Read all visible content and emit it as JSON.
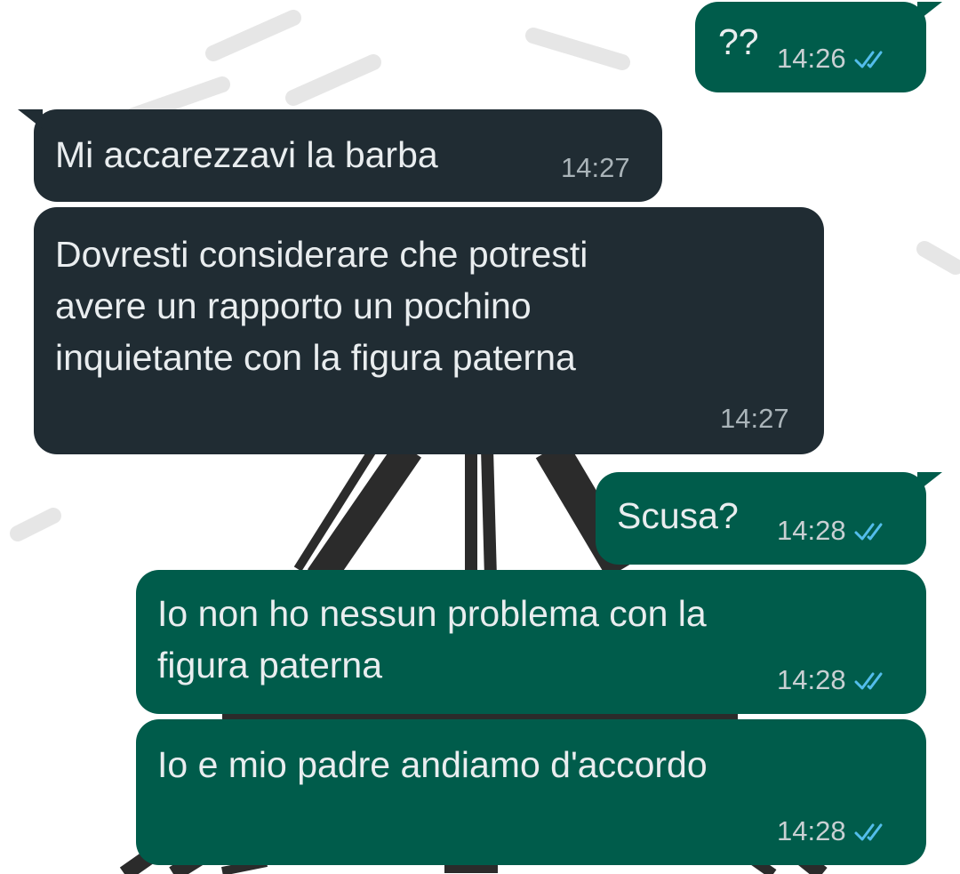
{
  "chat": {
    "messages": [
      {
        "id": "m1",
        "direction": "outgoing",
        "lines": [
          "??"
        ],
        "time": "14:26",
        "status_icon": "double-check-read-icon"
      },
      {
        "id": "m2",
        "direction": "incoming",
        "lines": [
          "Mi accarezzavi la barba"
        ],
        "time": "14:27"
      },
      {
        "id": "m3",
        "direction": "incoming",
        "lines": [
          "Dovresti considerare che potresti",
          "avere un rapporto un pochino",
          "inquietante con la figura paterna"
        ],
        "time": "14:27"
      },
      {
        "id": "m4",
        "direction": "outgoing",
        "lines": [
          "Scusa?"
        ],
        "time": "14:28",
        "status_icon": "double-check-read-icon"
      },
      {
        "id": "m5",
        "direction": "outgoing",
        "lines": [
          "Io non ho nessun problema con la",
          "figura paterna"
        ],
        "time": "14:28",
        "status_icon": "double-check-read-icon"
      },
      {
        "id": "m6",
        "direction": "outgoing",
        "lines": [
          "Io e mio padre andiamo d'accordo"
        ],
        "time": "14:28",
        "status_icon": "double-check-read-icon"
      }
    ]
  },
  "colors": {
    "incoming_bubble": "#202c33",
    "outgoing_bubble": "#005c4b",
    "message_text": "#e9edef",
    "read_ticks": "#53bdeb",
    "background": "#ffffff"
  }
}
